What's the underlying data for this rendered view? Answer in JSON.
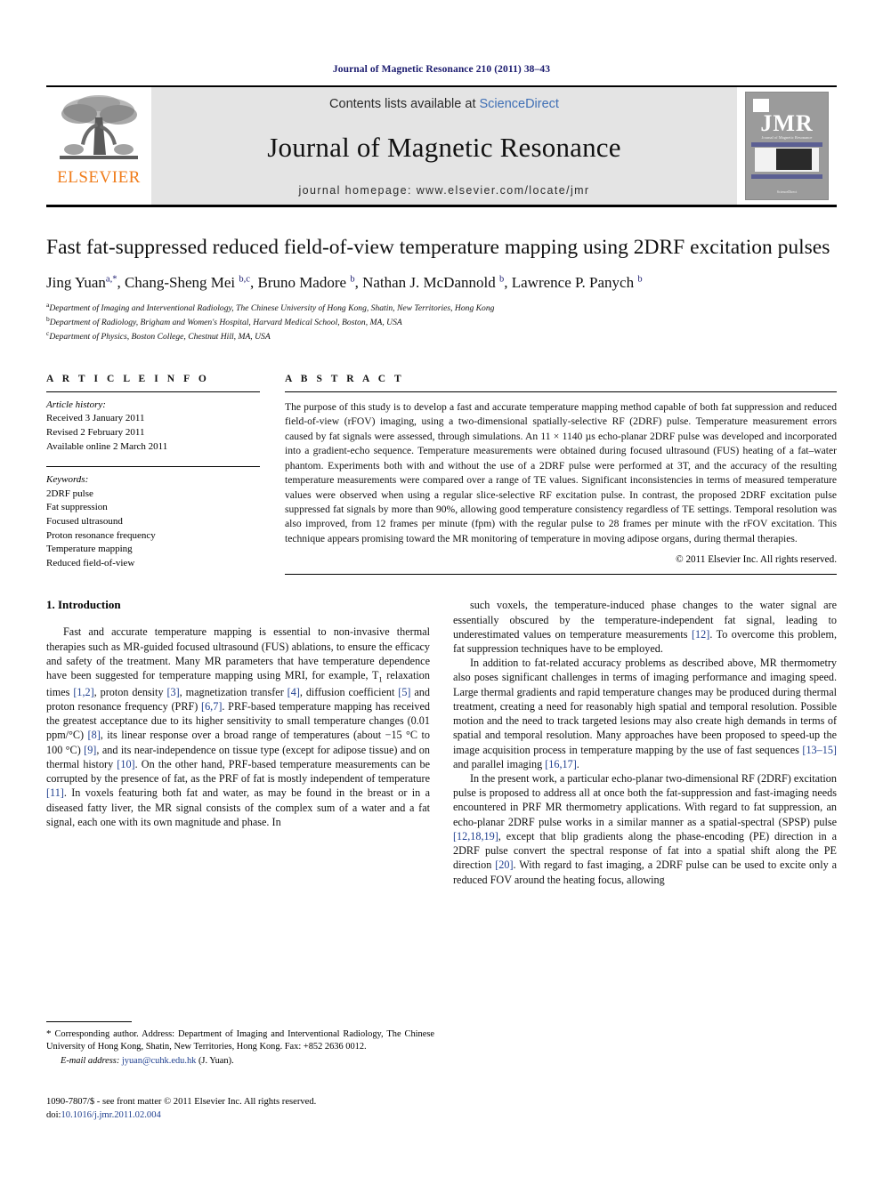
{
  "running_head": "Journal of Magnetic Resonance 210 (2011) 38–43",
  "masthead": {
    "publisher_wordmark": "ELSEVIER",
    "contents_prefix": "Contents lists available at ",
    "contents_link": "ScienceDirect",
    "journal_name": "Journal of Magnetic Resonance",
    "homepage": "journal homepage: www.elsevier.com/locate/jmr",
    "cover": {
      "acronym": "JMR",
      "subtitle": "Journal of Magnetic Resonance",
      "footer": "ScienceDirect"
    },
    "colors": {
      "elsevier_orange": "#f07c1a",
      "link_blue": "#3f6fb5",
      "band_grey": "#e4e4e4"
    }
  },
  "article": {
    "title": "Fast fat-suppressed reduced field-of-view temperature mapping using 2DRF excitation pulses",
    "authors_html": "Jing Yuan<sup>a,</sup><sup>*</sup>, Chang-Sheng Mei <sup>b,c</sup>, Bruno Madore <sup>b</sup>, Nathan J. McDannold <sup>b</sup>, Lawrence P. Panych <sup>b</sup>",
    "affiliations": [
      {
        "marker": "a",
        "text": "Department of Imaging and Interventional Radiology, The Chinese University of Hong Kong, Shatin, New Territories, Hong Kong"
      },
      {
        "marker": "b",
        "text": "Department of Radiology, Brigham and Women's Hospital, Harvard Medical School, Boston, MA, USA"
      },
      {
        "marker": "c",
        "text": "Department of Physics, Boston College, Chestnut Hill, MA, USA"
      }
    ]
  },
  "article_info": {
    "heading": "A R T I C L E  I N F O",
    "history_label": "Article history:",
    "history": [
      "Received 3 January 2011",
      "Revised 2 February 2011",
      "Available online 2 March 2011"
    ],
    "keywords_label": "Keywords:",
    "keywords": [
      "2DRF pulse",
      "Fat suppression",
      "Focused ultrasound",
      "Proton resonance frequency",
      "Temperature mapping",
      "Reduced field-of-view"
    ]
  },
  "abstract": {
    "heading": "A B S T R A C T",
    "text": "The purpose of this study is to develop a fast and accurate temperature mapping method capable of both fat suppression and reduced field-of-view (rFOV) imaging, using a two-dimensional spatially-selective RF (2DRF) pulse. Temperature measurement errors caused by fat signals were assessed, through simulations. An 11 × 1140 µs echo-planar 2DRF pulse was developed and incorporated into a gradient-echo sequence. Temperature measurements were obtained during focused ultrasound (FUS) heating of a fat–water phantom. Experiments both with and without the use of a 2DRF pulse were performed at 3T, and the accuracy of the resulting temperature measurements were compared over a range of TE values. Significant inconsistencies in terms of measured temperature values were observed when using a regular slice-selective RF excitation pulse. In contrast, the proposed 2DRF excitation pulse suppressed fat signals by more than 90%, allowing good temperature consistency regardless of TE settings. Temporal resolution was also improved, from 12 frames per minute (fpm) with the regular pulse to 28 frames per minute with the rFOV excitation. This technique appears promising toward the MR monitoring of temperature in moving adipose organs, during thermal therapies.",
    "copyright": "© 2011 Elsevier Inc. All rights reserved."
  },
  "body": {
    "section1_heading": "1. Introduction",
    "left_paragraphs_html": [
      "Fast and accurate temperature mapping is essential to non-invasive thermal therapies such as MR-guided focused ultrasound (FUS) ablations, to ensure the efficacy and safety of the treatment. Many MR parameters that have temperature dependence have been suggested for temperature mapping using MRI, for example, T<sub class=\"smallsub\">1</sub> relaxation times <span class=\"ref\">[1,2]</span>, proton density <span class=\"ref\">[3]</span>, magnetization transfer <span class=\"ref\">[4]</span>, diffusion coefficient <span class=\"ref\">[5]</span> and proton resonance frequency (PRF) <span class=\"ref\">[6,7]</span>. PRF-based temperature mapping has received the greatest acceptance due to its higher sensitivity to small temperature changes (0.01 ppm/°C) <span class=\"ref\">[8]</span>, its linear response over a broad range of temperatures (about −15 °C to 100 °C) <span class=\"ref\">[9]</span>, and its near-independence on tissue type (except for adipose tissue) and on thermal history <span class=\"ref\">[10]</span>. On the other hand, PRF-based temperature measurements can be corrupted by the presence of fat, as the PRF of fat is mostly independent of temperature <span class=\"ref\">[11]</span>. In voxels featuring both fat and water, as may be found in the breast or in a diseased fatty liver, the MR signal consists of the complex sum of a water and a fat signal, each one with its own magnitude and phase. In"
    ],
    "right_paragraphs_html": [
      "such voxels, the temperature-induced phase changes to the water signal are essentially obscured by the temperature-independent fat signal, leading to underestimated values on temperature measurements <span class=\"ref\">[12]</span>. To overcome this problem, fat suppression techniques have to be employed.",
      "In addition to fat-related accuracy problems as described above, MR thermometry also poses significant challenges in terms of imaging performance and imaging speed. Large thermal gradients and rapid temperature changes may be produced during thermal treatment, creating a need for reasonably high spatial and temporal resolution. Possible motion and the need to track targeted lesions may also create high demands in terms of spatial and temporal resolution. Many approaches have been proposed to speed-up the image acquisition process in temperature mapping by the use of fast sequences <span class=\"ref\">[13–15]</span> and parallel imaging <span class=\"ref\">[16,17]</span>.",
      "In the present work, a particular echo-planar two-dimensional RF (2DRF) excitation pulse is proposed to address all at once both the fat-suppression and fast-imaging needs encountered in PRF MR thermometry applications. With regard to fat suppression, an echo-planar 2DRF pulse works in a similar manner as a spatial-spectral (SPSP) pulse <span class=\"ref\">[12,18,19]</span>, except that blip gradients along the phase-encoding (PE) direction in a 2DRF pulse convert the spectral response of fat into a spatial shift along the PE direction <span class=\"ref\">[20]</span>. With regard to fast imaging, a 2DRF pulse can be used to excite only a reduced FOV around the heating focus, allowing"
    ]
  },
  "footnote": {
    "star": "*",
    "text": " Corresponding author. Address: Department of Imaging and Interventional Radiology, The Chinese University of Hong Kong, Shatin, New Territories, Hong Kong. Fax: +852 2636 0012.",
    "email_label": "E-mail address:",
    "email": "jyuan@cuhk.edu.hk",
    "email_suffix": " (J. Yuan)."
  },
  "page_footer": {
    "line1": "1090-7807/$ - see front matter © 2011 Elsevier Inc. All rights reserved.",
    "doi_prefix": "doi:",
    "doi": "10.1016/j.jmr.2011.02.004"
  }
}
